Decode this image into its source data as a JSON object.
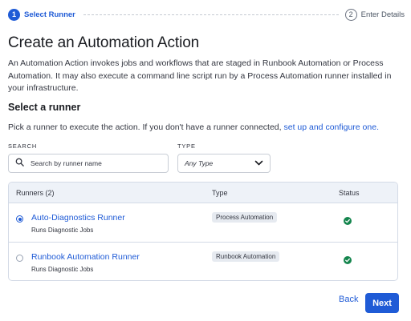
{
  "stepper": {
    "step1": {
      "number": "1",
      "label": "Select Runner"
    },
    "step2": {
      "number": "2",
      "label": "Enter Details"
    }
  },
  "page": {
    "title": "Create an Automation Action",
    "description": "An Automation Action invokes jobs and workflows that are staged in Runbook Automation or Process Automation. It may also execute a command line script run by a Process Automation runner installed in your infrastructure.",
    "section_title": "Select a runner",
    "pick_text": "Pick a runner to execute the action. If you don't have a runner connected, ",
    "pick_link": "set up and configure one."
  },
  "filters": {
    "search_label": "SEARCH",
    "search_placeholder": "Search by runner name",
    "type_label": "TYPE",
    "type_value": "Any Type"
  },
  "table": {
    "headers": {
      "runners": "Runners (2)",
      "type": "Type",
      "status": "Status"
    },
    "rows": [
      {
        "name": "Auto-Diagnostics Runner",
        "subtitle": "Runs Diagnostic Jobs",
        "type": "Process Automation",
        "status": "healthy",
        "selected": true
      },
      {
        "name": "Runbook Automation Runner",
        "subtitle": "Runs Diagnostic Jobs",
        "type": "Runbook Automation",
        "status": "healthy",
        "selected": false
      }
    ]
  },
  "footer": {
    "back_label": "Back",
    "next_label": "Next"
  },
  "colors": {
    "accent": "#1f5bd6",
    "success": "#14854d",
    "table_header_bg": "#eef2f8"
  },
  "icons": {
    "search": "search-icon",
    "dropdown": "chevron-down-icon",
    "status": "check-circle-icon"
  }
}
